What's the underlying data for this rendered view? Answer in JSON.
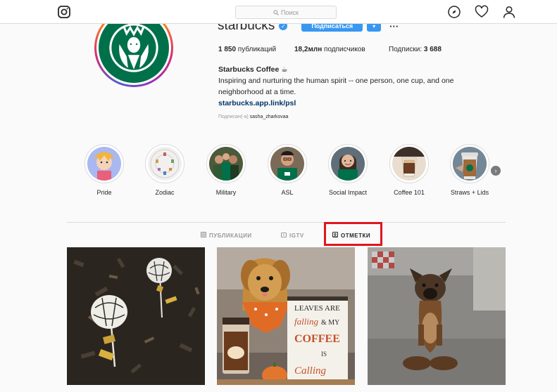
{
  "nav": {
    "search_placeholder": "Поиск",
    "icons": [
      "instagram-logo-icon",
      "search-icon",
      "compass-icon",
      "heart-icon",
      "user-icon"
    ]
  },
  "profile": {
    "username": "starbucks",
    "follow_label": "Подписаться",
    "more_label": "···",
    "stats": [
      {
        "count": "1 850",
        "label": " публикаций"
      },
      {
        "count": "18,2млн",
        "label": " подписчиков"
      },
      {
        "count": "3 688",
        "label": "Подписки: "
      }
    ],
    "bio_name": "Starbucks Coffee ☕",
    "bio_line1": "Inspiring and nurturing the human spirit -- one person, one cup, and one",
    "bio_line2": "neighborhood at a time.",
    "bio_link": "starbucks.app.link/psl",
    "followed_by_prefix": "Подписан(-а) ",
    "followed_by_user": "sasha_zharkovaa"
  },
  "highlights": [
    {
      "label": "Pride"
    },
    {
      "label": "Zodiac"
    },
    {
      "label": "Military"
    },
    {
      "label": "ASL"
    },
    {
      "label": "Social Impact"
    },
    {
      "label": "Coffee 101"
    },
    {
      "label": "Straws + Lids"
    }
  ],
  "tabs": [
    {
      "label": "ПУБЛИКАЦИИ",
      "active": false
    },
    {
      "label": "IGTV",
      "active": false
    },
    {
      "label": "ОТМЕТКИ",
      "active": true
    }
  ],
  "colors": {
    "accent": "#3897f0",
    "highlight_box": "#e0161d",
    "starbucks_green": "#00704a"
  }
}
